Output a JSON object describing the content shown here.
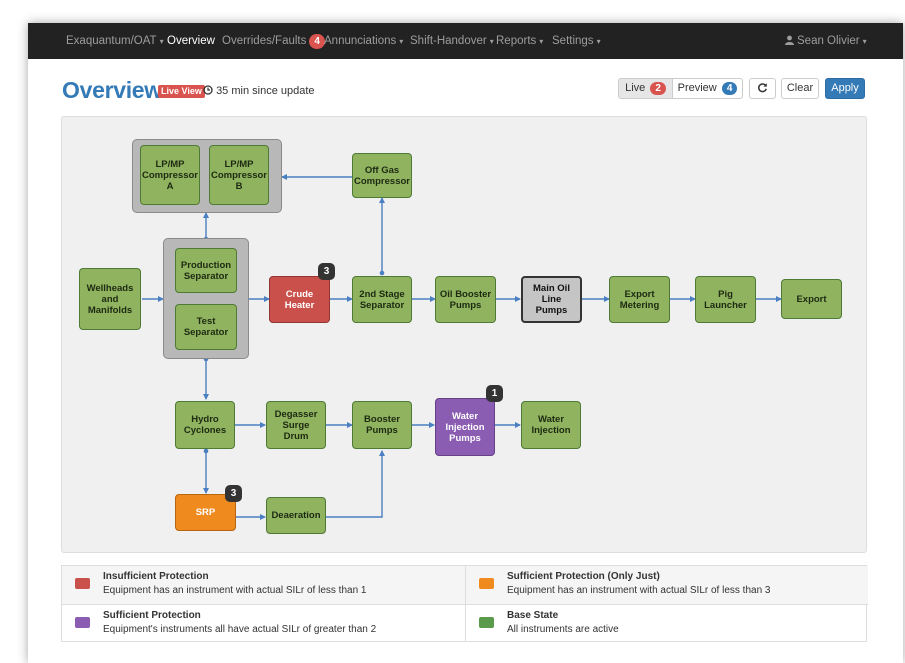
{
  "nav": {
    "brand": "Exaquantum/OAT",
    "items": [
      {
        "label": "Overview"
      },
      {
        "label": "Overrides/Faults",
        "badge": "4"
      },
      {
        "label": "Annunciations"
      },
      {
        "label": "Shift-Handover"
      },
      {
        "label": "Reports"
      },
      {
        "label": "Settings"
      }
    ],
    "user": "Sean Olivier",
    "caret": "▾",
    "user_icon": "user-icon"
  },
  "header": {
    "title": "Overview",
    "live_label": "Live View",
    "update_text": "35 min since update",
    "clock_icon": "clock-icon"
  },
  "toolbar": {
    "live_label": "Live",
    "live_count": "2",
    "preview_label": "Preview",
    "preview_count": "4",
    "refresh_icon": "refresh-icon",
    "clear_label": "Clear",
    "apply_label": "Apply"
  },
  "diagram": {
    "nodes": {
      "lp_comp_a": "LP/MP Compressor A",
      "lp_comp_b": "LP/MP Compressor B",
      "off_gas": "Off Gas Compressor",
      "wellheads": "Wellheads and Manifolds",
      "prod_sep": "Production Separator",
      "test_sep": "Test Separator",
      "crude_heater": "Crude Heater",
      "stage2_sep": "2nd Stage Separator",
      "oil_booster": "Oil Booster Pumps",
      "main_oil": "Main Oil Line Pumps",
      "export_metering": "Export Metering",
      "pig_launcher": "Pig Launcher",
      "export": "Export",
      "hydro": "Hydro Cyclones",
      "degasser": "Degasser Surge Drum",
      "booster": "Booster Pumps",
      "water_inj_pumps": "Water Injection Pumps",
      "water_inj": "Water Injection",
      "srp": "SRP",
      "deaeration": "Deaeration"
    },
    "badges": {
      "crude_heater": "3",
      "water_inj_pumps": "1",
      "srp": "3"
    }
  },
  "legend": [
    {
      "title": "Insufficient Protection",
      "desc": "Equipment has an instrument with actual SILr of less than 1",
      "color": "#c9504b"
    },
    {
      "title": "Sufficient Protection (Only Just)",
      "desc": "Equipment has an instrument with actual SILr of less than 3",
      "color": "#ef8a1e"
    },
    {
      "title": "Sufficient Protection",
      "desc": "Equipment's instruments all have actual SILr of greater than 2",
      "color": "#8a5cb2"
    },
    {
      "title": "Base State",
      "desc": "All instruments are active",
      "color": "#5a9a4b"
    }
  ]
}
